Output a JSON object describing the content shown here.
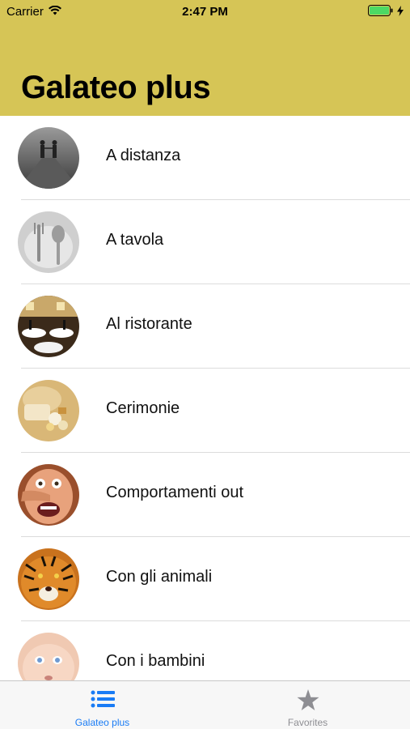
{
  "status_bar": {
    "carrier": "Carrier",
    "time": "2:47 PM",
    "battery_color": "#4cd964"
  },
  "nav": {
    "title": "Galateo plus",
    "background": "#d6c556"
  },
  "list": {
    "items": [
      {
        "label": "A distanza",
        "thumb": "couple-on-road-photo"
      },
      {
        "label": "A tavola",
        "thumb": "fork-and-spoon-photo"
      },
      {
        "label": "Al ristorante",
        "thumb": "banquet-hall-photo"
      },
      {
        "label": "Cerimonie",
        "thumb": "wedding-favors-photo"
      },
      {
        "label": "Comportamenti out",
        "thumb": "face-with-hand-photo"
      },
      {
        "label": "Con gli animali",
        "thumb": "tiger-photo"
      },
      {
        "label": "Con i bambini",
        "thumb": "baby-face-photo"
      }
    ]
  },
  "tabs": [
    {
      "label": "Galateo plus",
      "icon": "list-icon",
      "active": true
    },
    {
      "label": "Favorites",
      "icon": "star-icon",
      "active": false
    }
  ],
  "colors": {
    "accent": "#1a7cf5",
    "inactive": "#8e8e93"
  }
}
